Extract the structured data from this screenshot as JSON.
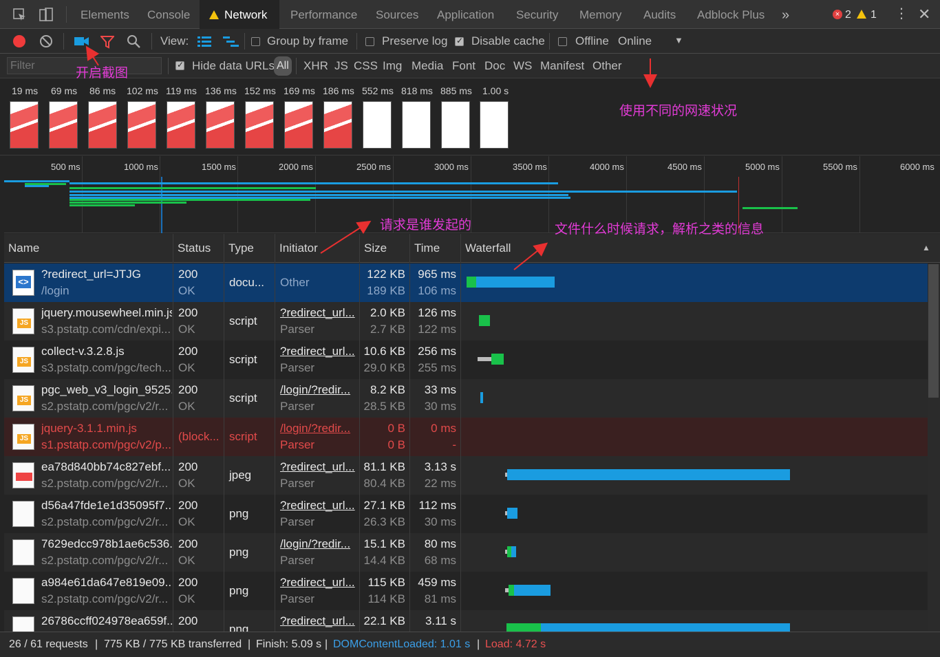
{
  "tabs": [
    "Elements",
    "Console",
    "Network",
    "Performance",
    "Sources",
    "Application",
    "Security",
    "Memory",
    "Audits",
    "Adblock Plus"
  ],
  "tab_more": "»",
  "errors": {
    "err_count": "2",
    "warn_count": "1"
  },
  "toolbar": {
    "view_label": "View:",
    "group_by_frame": "Group by frame",
    "preserve_log": "Preserve log",
    "disable_cache": "Disable cache",
    "offline": "Offline",
    "throttle": "Online"
  },
  "filter": {
    "placeholder": "Filter",
    "hide_data_urls": "Hide data URLs",
    "types": [
      "All",
      "XHR",
      "JS",
      "CSS",
      "Img",
      "Media",
      "Font",
      "Doc",
      "WS",
      "Manifest",
      "Other"
    ]
  },
  "filmstrip": {
    "times": [
      "19 ms",
      "69 ms",
      "86 ms",
      "102 ms",
      "119 ms",
      "136 ms",
      "152 ms",
      "169 ms",
      "186 ms",
      "552 ms",
      "818 ms",
      "885 ms",
      "1.00 s"
    ]
  },
  "overview": {
    "ticks": [
      "500 ms",
      "1000 ms",
      "1500 ms",
      "2000 ms",
      "2500 ms",
      "3000 ms",
      "3500 ms",
      "4000 ms",
      "4500 ms",
      "5000 ms",
      "5500 ms",
      "6000 ms"
    ]
  },
  "columns": [
    "Name",
    "Status",
    "Type",
    "Initiator",
    "Size",
    "Time",
    "Waterfall"
  ],
  "requests": [
    {
      "name": "?redirect_url=JTJG",
      "path": "/login",
      "status": "200",
      "status_text": "OK",
      "type": "docu...",
      "initiator": "Other",
      "initiator_sub": "",
      "size": "122 KB",
      "size2": "189 KB",
      "time": "965 ms",
      "time2": "106 ms",
      "icon": "document-icon"
    },
    {
      "name": "jquery.mousewheel.min.js",
      "path": "s3.pstatp.com/cdn/expi...",
      "status": "200",
      "status_text": "OK",
      "type": "script",
      "initiator": "?redirect_url...",
      "initiator_sub": "Parser",
      "size": "2.0 KB",
      "size2": "2.7 KB",
      "time": "126 ms",
      "time2": "122 ms",
      "icon": "js-file-icon"
    },
    {
      "name": "collect-v.3.2.8.js",
      "path": "s3.pstatp.com/pgc/tech...",
      "status": "200",
      "status_text": "OK",
      "type": "script",
      "initiator": "?redirect_url...",
      "initiator_sub": "Parser",
      "size": "10.6 KB",
      "size2": "29.0 KB",
      "time": "256 ms",
      "time2": "255 ms",
      "icon": "js-file-icon"
    },
    {
      "name": "pgc_web_v3_login_9525...",
      "path": "s2.pstatp.com/pgc/v2/r...",
      "status": "200",
      "status_text": "OK",
      "type": "script",
      "initiator": "/login/?redir...",
      "initiator_sub": "Parser",
      "size": "8.2 KB",
      "size2": "28.5 KB",
      "time": "33 ms",
      "time2": "30 ms",
      "icon": "js-file-icon"
    },
    {
      "name": "jquery-3.1.1.min.js",
      "path": "s1.pstatp.com/pgc/v2/p...",
      "status": "(block...",
      "status_text": "",
      "type": "script",
      "initiator": "/login/?redir...",
      "initiator_sub": "Parser",
      "size": "0 B",
      "size2": "0 B",
      "time": "0 ms",
      "time2": "-",
      "icon": "js-file-icon"
    },
    {
      "name": "ea78d840bb74c827ebf...",
      "path": "s2.pstatp.com/pgc/v2/r...",
      "status": "200",
      "status_text": "OK",
      "type": "jpeg",
      "initiator": "?redirect_url...",
      "initiator_sub": "Parser",
      "size": "81.1 KB",
      "size2": "80.4 KB",
      "time": "3.13 s",
      "time2": "22 ms",
      "icon": "image-thumbnail-icon"
    },
    {
      "name": "d56a47fde1e1d35095f7...",
      "path": "s2.pstatp.com/pgc/v2/r...",
      "status": "200",
      "status_text": "OK",
      "type": "png",
      "initiator": "?redirect_url...",
      "initiator_sub": "Parser",
      "size": "27.1 KB",
      "size2": "26.3 KB",
      "time": "112 ms",
      "time2": "30 ms",
      "icon": "image-thumbnail-icon"
    },
    {
      "name": "7629edcc978b1ae6c536...",
      "path": "s2.pstatp.com/pgc/v2/r...",
      "status": "200",
      "status_text": "OK",
      "type": "png",
      "initiator": "/login/?redir...",
      "initiator_sub": "Parser",
      "size": "15.1 KB",
      "size2": "14.4 KB",
      "time": "80 ms",
      "time2": "68 ms",
      "icon": "image-thumbnail-icon"
    },
    {
      "name": "a984e61da647e819e09...",
      "path": "s2.pstatp.com/pgc/v2/r...",
      "status": "200",
      "status_text": "OK",
      "type": "png",
      "initiator": "?redirect_url...",
      "initiator_sub": "Parser",
      "size": "115 KB",
      "size2": "114 KB",
      "time": "459 ms",
      "time2": "81 ms",
      "icon": "image-thumbnail-icon"
    },
    {
      "name": "26786ccff024978ea659f...",
      "path": "",
      "status": "200",
      "status_text": "",
      "type": "png",
      "initiator": "?redirect_url...",
      "initiator_sub": "",
      "size": "22.1 KB",
      "size2": "",
      "time": "3.11 s",
      "time2": "",
      "icon": "image-thumbnail-icon"
    }
  ],
  "status_bar": {
    "requests": "26 / 61 requests",
    "transferred": "775 KB / 775 KB transferred",
    "finish": "Finish: 5.09 s",
    "dcl": "DOMContentLoaded: 1.01 s",
    "load": "Load: 4.72 s"
  },
  "annotations": {
    "screenshot": "开启截图",
    "network_speed": "使用不同的网速状况",
    "initiator": "请求是谁发起的",
    "timing": "文件什么时候请求，解析之类的信息"
  },
  "colors": {
    "accent_blue": "#1a9ce0",
    "green": "#19c14a",
    "error_red": "#e03c3c",
    "selected_row": "#0d3b6e",
    "annotation": "#e23bd6"
  }
}
